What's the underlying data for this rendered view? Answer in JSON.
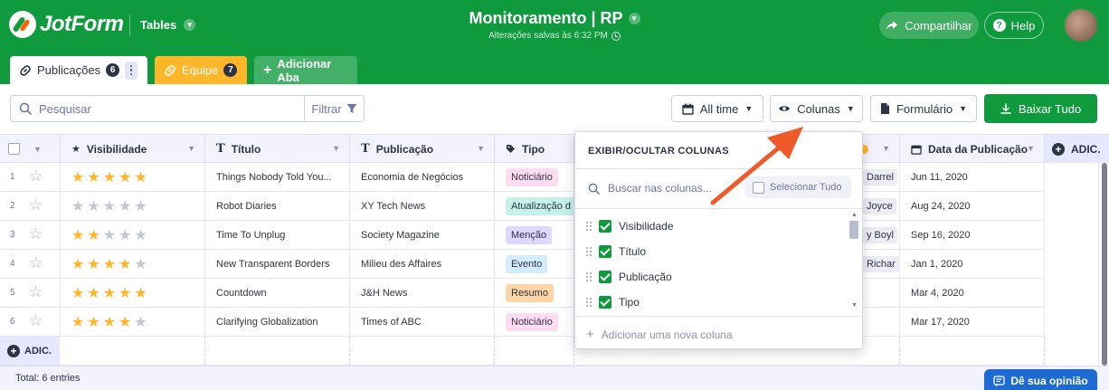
{
  "header": {
    "logo_text": "JotForm",
    "tables_label": "Tables",
    "title": "Monitoramento | RP",
    "saved_status": "Alterações salvas às 6:32 PM",
    "share_label": "Compartilhar",
    "help_label": "Help"
  },
  "tabs": [
    {
      "label": "Publicações",
      "count": "6"
    },
    {
      "label": "Equipe",
      "count": "7"
    },
    {
      "label": "Adicionar Aba"
    }
  ],
  "toolbar": {
    "search_placeholder": "Pesquisar",
    "filter_label": "Filtrar",
    "alltime_label": "All time",
    "columns_label": "Colunas",
    "form_label": "Formulário",
    "download_label": "Baixar Tudo"
  },
  "columns": {
    "visibilidade": "Visibilidade",
    "titulo": "Título",
    "publicacao": "Publicação",
    "tipo": "Tipo",
    "data": "Data da Publicação",
    "add": "ADIC."
  },
  "rows": [
    {
      "num": "1",
      "rating": 5,
      "titulo": "Things Nobody Told You...",
      "publicacao": "Economia de Negócios",
      "tipo": "Noticiário",
      "pessoa": "Darrel",
      "data": "Jun 11, 2020"
    },
    {
      "num": "2",
      "rating": 0,
      "titulo": "Robot Diaries",
      "publicacao": "XY Tech News",
      "tipo": "Atualização d",
      "pessoa": "Joyce",
      "data": "Aug 24, 2020"
    },
    {
      "num": "3",
      "rating": 2,
      "titulo": "Time To Unplug",
      "publicacao": "Society Magazine",
      "tipo": "Menção",
      "pessoa": "y Boyl",
      "data": "Sep 16, 2020"
    },
    {
      "num": "4",
      "rating": 4,
      "titulo": "New Transparent Borders",
      "publicacao": "Milieu des Affaires",
      "tipo": "Evento",
      "pessoa": "Richar",
      "data": "Jan 1, 2020"
    },
    {
      "num": "5",
      "rating": 5,
      "titulo": "Countdown",
      "publicacao": "J&H News",
      "tipo": "Resumo",
      "pessoa": "",
      "data": "Mar 4, 2020"
    },
    {
      "num": "6",
      "rating": 4,
      "titulo": "Clarifying Globalization",
      "publicacao": "Times of ABC",
      "tipo": "Noticiário",
      "pessoa": "",
      "data": "Mar 17, 2020"
    }
  ],
  "add_row_label": "ADIC.",
  "footer": {
    "total": "Total: 6 entries",
    "feedback_label": "Dê sua opinião"
  },
  "columns_panel": {
    "title": "EXIBIR/OCULTAR COLUNAS",
    "search_placeholder": "Buscar nas colunas...",
    "select_all_label": "Selecionar Tudo",
    "items": [
      {
        "label": "Visibilidade",
        "checked": true
      },
      {
        "label": "Título",
        "checked": true
      },
      {
        "label": "Publicação",
        "checked": true
      },
      {
        "label": "Tipo",
        "checked": true
      }
    ],
    "add_column_label": "Adicionar uma nova coluna"
  },
  "colors": {
    "brand_green": "#0f9a3d",
    "tab_orange": "#ffb629",
    "star_on": "#ffb629",
    "arrow": "#ee5a2a",
    "feedback_blue": "#1e6ad3"
  }
}
